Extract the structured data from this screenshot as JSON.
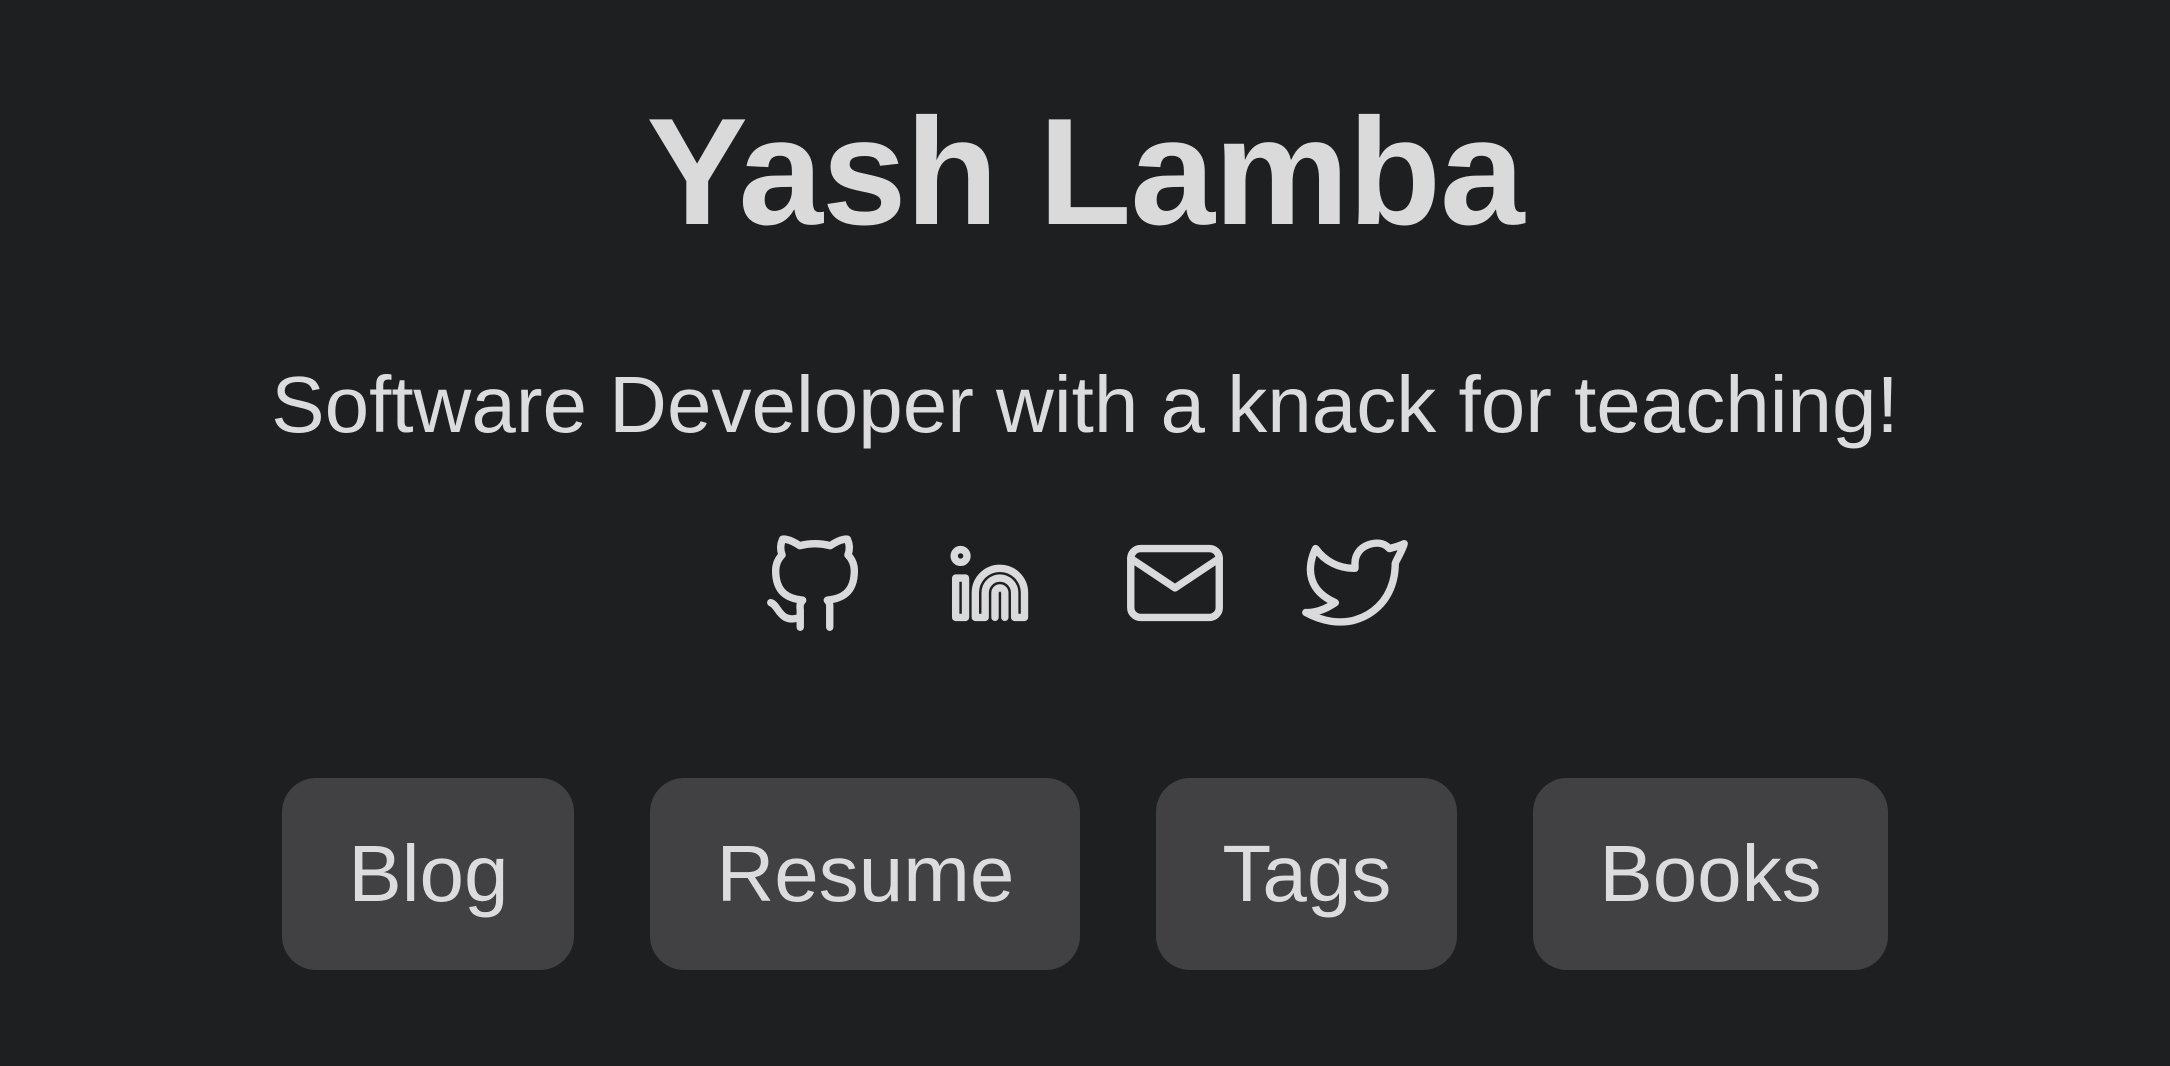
{
  "header": {
    "name": "Yash Lamba",
    "tagline": "Software Developer with a knack for teaching!"
  },
  "socials": [
    {
      "icon": "github-icon"
    },
    {
      "icon": "linkedin-icon"
    },
    {
      "icon": "mail-icon"
    },
    {
      "icon": "twitter-icon"
    }
  ],
  "nav": {
    "blog_label": "Blog",
    "resume_label": "Resume",
    "tags_label": "Tags",
    "books_label": "Books"
  },
  "colors": {
    "background": "#1e1f21",
    "text": "#dadadc",
    "button_bg": "#414143"
  }
}
